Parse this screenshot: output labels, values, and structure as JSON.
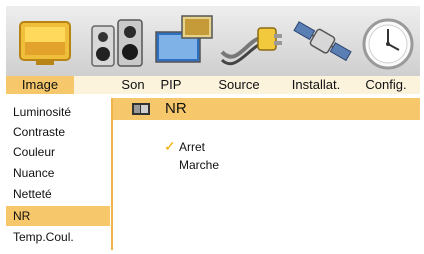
{
  "tabs": [
    {
      "label": "Image",
      "active": true
    },
    {
      "label": "Son",
      "active": false
    },
    {
      "label": "PIP",
      "active": false
    },
    {
      "label": "Source",
      "active": false
    },
    {
      "label": "Installat.",
      "active": false
    },
    {
      "label": "Config.",
      "active": false
    }
  ],
  "menu": {
    "items": [
      {
        "label": "Luminosité"
      },
      {
        "label": "Contraste"
      },
      {
        "label": "Couleur"
      },
      {
        "label": "Nuance"
      },
      {
        "label": "Netteté"
      },
      {
        "label": "NR",
        "selected": true
      },
      {
        "label": "Temp.Coul."
      }
    ]
  },
  "panel": {
    "title": "NR",
    "options": [
      {
        "label": "Arret",
        "checked": true
      },
      {
        "label": "Marche",
        "checked": false
      }
    ],
    "check_glyph": "✓"
  },
  "colors": {
    "highlight": "#f6c86b",
    "tabbar": "#fbf3dc",
    "check": "#f2a900"
  },
  "icons": [
    "image-tv-icon",
    "speakers-icon",
    "pip-screens-icon",
    "source-cable-icon",
    "satellite-icon",
    "clock-icon"
  ]
}
